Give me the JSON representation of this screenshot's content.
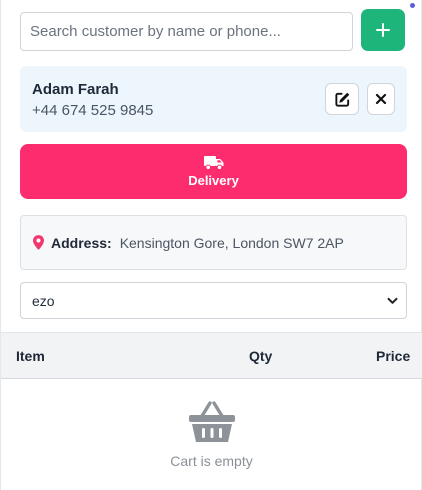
{
  "search": {
    "placeholder": "Search customer by name or phone...",
    "value": ""
  },
  "add_customer": {
    "icon": "plus-icon"
  },
  "customer": {
    "name": "Adam Farah",
    "phone": "+44 674 525 9845",
    "edit_icon": "edit-icon",
    "clear_icon": "close-icon"
  },
  "order_type": {
    "label": "Delivery",
    "icon": "truck-icon",
    "color": "#fd2c6f"
  },
  "address": {
    "label": "Address:",
    "value": "Kensington Gore, London SW7 2AP",
    "icon": "map-pin-icon"
  },
  "select": {
    "selected": "ezo"
  },
  "cart": {
    "columns": [
      "Item",
      "Qty",
      "Price"
    ],
    "empty_text": "Cart is empty",
    "empty_icon": "basket-icon"
  },
  "colors": {
    "accent_green": "#1db57a",
    "accent_pink": "#fd2c6f",
    "card_bg": "#edf5fd"
  }
}
